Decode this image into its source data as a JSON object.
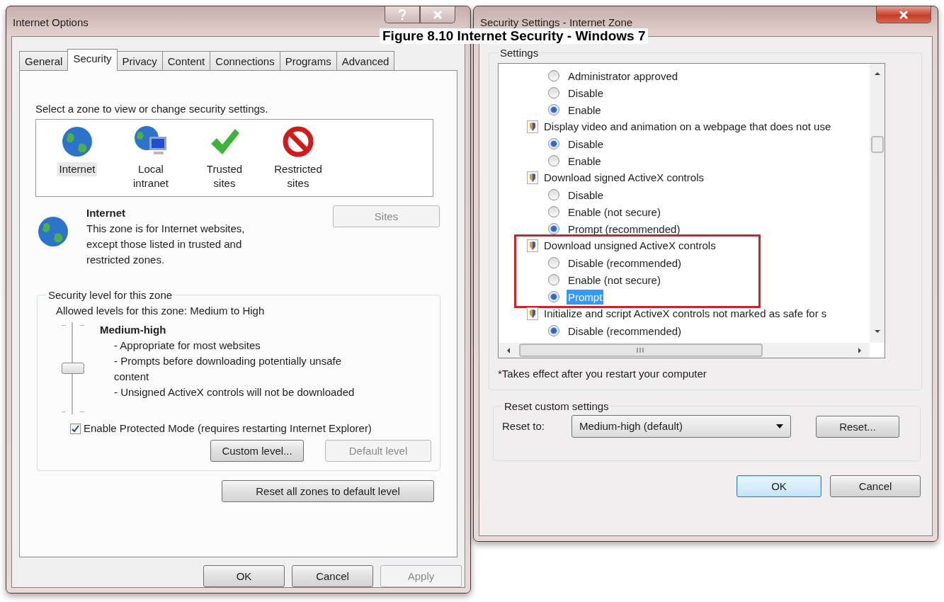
{
  "caption": "Figure 8.10 Internet Security - Windows 7",
  "internet_options": {
    "title": "Internet Options",
    "tabs": [
      {
        "label": "General",
        "selected": false
      },
      {
        "label": "Security",
        "selected": true
      },
      {
        "label": "Privacy",
        "selected": false
      },
      {
        "label": "Content",
        "selected": false
      },
      {
        "label": "Connections",
        "selected": false
      },
      {
        "label": "Programs",
        "selected": false
      },
      {
        "label": "Advanced",
        "selected": false
      }
    ],
    "zone_prompt": "Select a zone to view or change security settings.",
    "zones": [
      {
        "label": "Internet",
        "kind": "globe",
        "selected": true
      },
      {
        "label": "Local intranet",
        "kind": "intranet",
        "selected": false
      },
      {
        "label": "Trusted sites",
        "kind": "check",
        "selected": false
      },
      {
        "label": "Restricted sites",
        "kind": "blocked",
        "selected": false
      }
    ],
    "zone_detail": {
      "name": "Internet",
      "description": "This zone is for Internet websites, except those listed in trusted and restricted zones."
    },
    "sites_button": {
      "label": "Sites",
      "disabled": true
    },
    "security_level": {
      "legend": "Security level for this zone",
      "allowed": "Allowed levels for this zone: Medium to High",
      "level": 0.5,
      "level_name": "Medium-high",
      "bullets": [
        "- Appropriate for most websites",
        "- Prompts before downloading potentially unsafe content",
        "- Unsigned ActiveX controls will not be downloaded"
      ]
    },
    "protected_mode": {
      "label": "Enable Protected Mode (requires restarting Internet Explorer)",
      "checked": true
    },
    "level_buttons": [
      {
        "label": "Custom level...",
        "disabled": false
      },
      {
        "label": "Default level",
        "disabled": true
      }
    ],
    "reset_all_button": "Reset all zones to default level",
    "footer_buttons": [
      {
        "label": "OK",
        "disabled": false
      },
      {
        "label": "Cancel",
        "disabled": false
      },
      {
        "label": "Apply",
        "disabled": true
      }
    ]
  },
  "security_settings": {
    "title": "Security Settings - Internet Zone",
    "settings_legend": "Settings",
    "groups": [
      {
        "annotated": false,
        "options": [
          {
            "label": "Administrator approved",
            "selected": false,
            "focused": false
          },
          {
            "label": "Disable",
            "selected": false,
            "focused": false
          },
          {
            "label": "Enable",
            "selected": true,
            "focused": false
          }
        ]
      },
      {
        "heading": "Display video and animation on a webpage that does not use",
        "annotated": false,
        "options": [
          {
            "label": "Disable",
            "selected": true,
            "focused": false
          },
          {
            "label": "Enable",
            "selected": false,
            "focused": false
          }
        ]
      },
      {
        "heading": "Download signed ActiveX controls",
        "annotated": false,
        "options": [
          {
            "label": "Disable",
            "selected": false,
            "focused": false
          },
          {
            "label": "Enable (not secure)",
            "selected": false,
            "focused": false
          },
          {
            "label": "Prompt (recommended)",
            "selected": true,
            "focused": false
          }
        ]
      },
      {
        "heading": "Download unsigned ActiveX controls",
        "annotated": true,
        "options": [
          {
            "label": "Disable (recommended)",
            "selected": false,
            "focused": false
          },
          {
            "label": "Enable (not secure)",
            "selected": false,
            "focused": false
          },
          {
            "label": "Prompt",
            "selected": true,
            "focused": true
          }
        ]
      },
      {
        "heading": "Initialize and script ActiveX controls not marked as safe for s",
        "annotated": false,
        "options": [
          {
            "label": "Disable (recommended)",
            "selected": true,
            "focused": false
          }
        ]
      }
    ],
    "note": "*Takes effect after you restart your computer",
    "reset_legend": "Reset custom settings",
    "reset_label": "Reset to:",
    "reset_value": "Medium-high (default)",
    "reset_button": "Reset...",
    "footer_buttons": [
      {
        "label": "OK",
        "default": true
      },
      {
        "label": "Cancel",
        "default": false
      }
    ]
  }
}
